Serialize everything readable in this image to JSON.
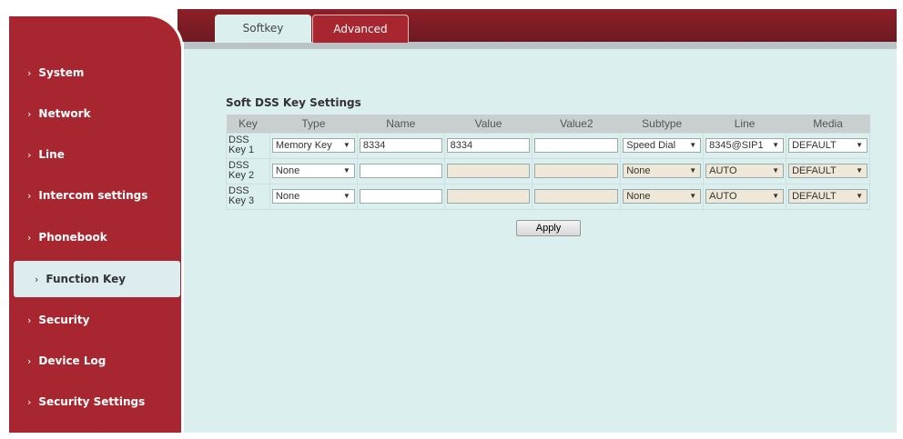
{
  "tabs": [
    "Softkey",
    "Advanced"
  ],
  "sidebar": [
    "System",
    "Network",
    "Line",
    "Intercom settings",
    "Phonebook",
    "Function Key",
    "Security",
    "Device Log",
    "Security Settings"
  ],
  "section_title": "Soft DSS Key Settings",
  "columns": [
    "Key",
    "Type",
    "Name",
    "Value",
    "Value2",
    "Subtype",
    "Line",
    "Media"
  ],
  "rows": [
    {
      "key1": "DSS",
      "key2": "Key 1",
      "type": "Memory Key",
      "name": "8334",
      "value": "8334",
      "value2": "",
      "subtype": "Speed Dial",
      "line": "8345@SIP1",
      "media": "DEFAULT"
    },
    {
      "key1": "DSS",
      "key2": "Key 2",
      "type": "None",
      "name": "",
      "value": "",
      "value2": "",
      "subtype": "None",
      "line": "AUTO",
      "media": "DEFAULT"
    },
    {
      "key1": "DSS",
      "key2": "Key 3",
      "type": "None",
      "name": "",
      "value": "",
      "value2": "",
      "subtype": "None",
      "line": "AUTO",
      "media": "DEFAULT"
    }
  ],
  "apply_label": "Apply",
  "dropdown_arrow": "▼"
}
